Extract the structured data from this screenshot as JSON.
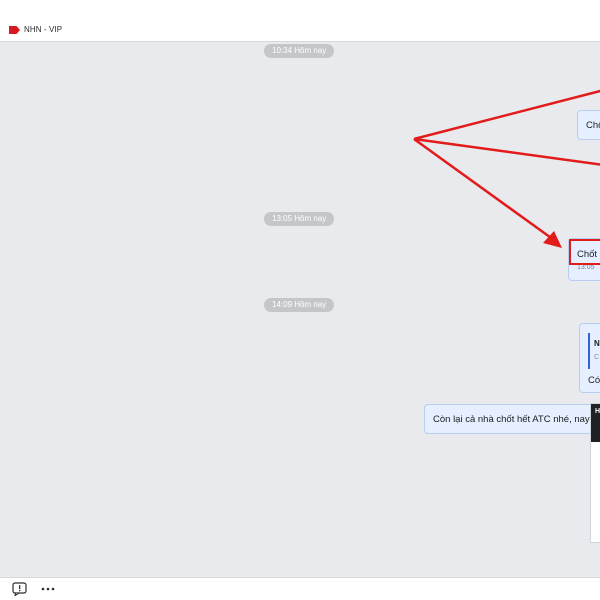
{
  "header": {
    "tag_label": "NHN - VIP",
    "tag_color": "#d71920"
  },
  "chat": {
    "timestamps": [
      "10:34 Hôm nay",
      "13:05 Hôm nay",
      "14:09 Hôm nay"
    ],
    "messages": [
      {
        "text": "Chố"
      },
      {
        "text": "Chốt",
        "time": "13:05"
      },
      {
        "quote_name": "N",
        "quote_sub": "C",
        "text": "Có"
      },
      {
        "text": "Còn lại cả nhà chốt hết ATC nhé, nay mìn"
      }
    ],
    "card": {
      "head_char": "H"
    }
  },
  "annotations": {
    "color": "#e21b1b"
  },
  "footer": {
    "icons": [
      "message-alert-icon",
      "more-options-icon"
    ]
  }
}
